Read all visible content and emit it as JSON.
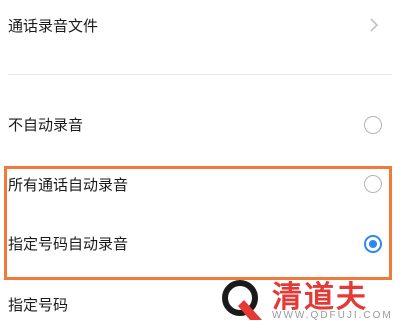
{
  "items": [
    {
      "label": "通话录音文件"
    },
    {
      "label": "不自动录音"
    },
    {
      "label": "所有通话自动录音"
    },
    {
      "label": "指定号码自动录音"
    },
    {
      "label": "指定号码"
    }
  ],
  "options": [
    {
      "label": "不自动录音",
      "checked": false
    },
    {
      "label": "所有通话自动录音",
      "checked": false
    },
    {
      "label": "指定号码自动录音",
      "checked": true
    }
  ],
  "watermark": {
    "name": "清道夫",
    "url": "WWW.QDFUJI.COM"
  },
  "colors": {
    "accent": "#2f86f6",
    "highlight": "#f07a3a",
    "watermark": "#e53935"
  }
}
